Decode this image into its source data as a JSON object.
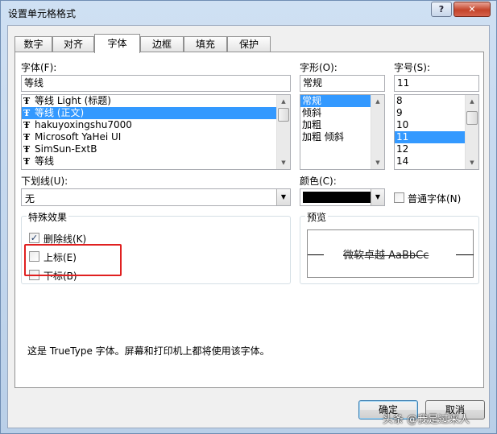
{
  "window": {
    "title": "设置单元格格式",
    "help": "?",
    "close": "✕"
  },
  "tabs": [
    "数字",
    "对齐",
    "字体",
    "边框",
    "填充",
    "保护"
  ],
  "font": {
    "label": "字体(F):",
    "value": "等线",
    "items": [
      "等线 Light (标题)",
      "等线 (正文)",
      "hakuyoxingshu7000",
      "Microsoft YaHei UI",
      "SimSun-ExtB",
      "等线"
    ],
    "icon": "Ŧ"
  },
  "style": {
    "label": "字形(O):",
    "value": "常规",
    "items": [
      "常规",
      "倾斜",
      "加粗",
      "加粗 倾斜"
    ]
  },
  "size": {
    "label": "字号(S):",
    "value": "11",
    "items": [
      "8",
      "9",
      "10",
      "11",
      "12",
      "14"
    ]
  },
  "underline": {
    "label": "下划线(U):",
    "value": "无"
  },
  "color": {
    "label": "颜色(C):",
    "value": "#000000",
    "normal_font_label": "普通字体(N)"
  },
  "effects": {
    "title": "特殊效果",
    "strikethrough": "删除线(K)",
    "superscript": "上标(E)",
    "subscript": "下标(B)",
    "strikethrough_checked": true,
    "check_mark": "✓"
  },
  "preview": {
    "title": "预览",
    "text": "微软卓越 AaBbCc"
  },
  "info": "这是 TrueType 字体。屏幕和打印机上都将使用该字体。",
  "buttons": {
    "ok": "确定",
    "cancel": "取消"
  },
  "scroll": {
    "up": "▲",
    "down": "▼"
  },
  "combo_arrow": "▼",
  "watermark": "头条 @我是过来人",
  "colors": {
    "selection": "#3399ff",
    "highlight_box": "#e02020"
  }
}
